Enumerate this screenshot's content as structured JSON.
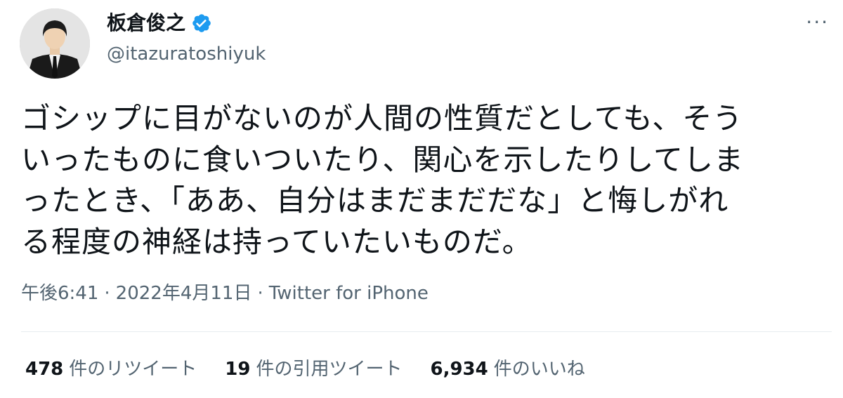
{
  "author": {
    "display_name": "板倉俊之",
    "handle": "@itazuratoshiyuk",
    "verified_icon": "verified-badge-icon",
    "verified_color": "#1d9bf0"
  },
  "menu": {
    "more_label": "···"
  },
  "tweet": {
    "text": "ゴシップに目がないのが人間の性質だとしても、そう\nいったものに食いついたり、関心を示したりしてしま\nったとき、「ああ、自分はまだまだだな」と悔しがれ\nる程度の神経は持っていたいものだ。"
  },
  "meta": {
    "time": "午後6:41",
    "separator1": "·",
    "date": "2022年4月11日",
    "separator2": "·",
    "source": "Twitter for iPhone"
  },
  "stats": {
    "retweets": {
      "count": "478",
      "label": "件のリツイート"
    },
    "quotes": {
      "count": "19",
      "label": "件の引用ツイート"
    },
    "likes": {
      "count": "6,934",
      "label": "件のいいね"
    }
  },
  "colors": {
    "text_primary": "#0f1419",
    "text_secondary": "#536471",
    "divider": "#e7ecf0"
  }
}
